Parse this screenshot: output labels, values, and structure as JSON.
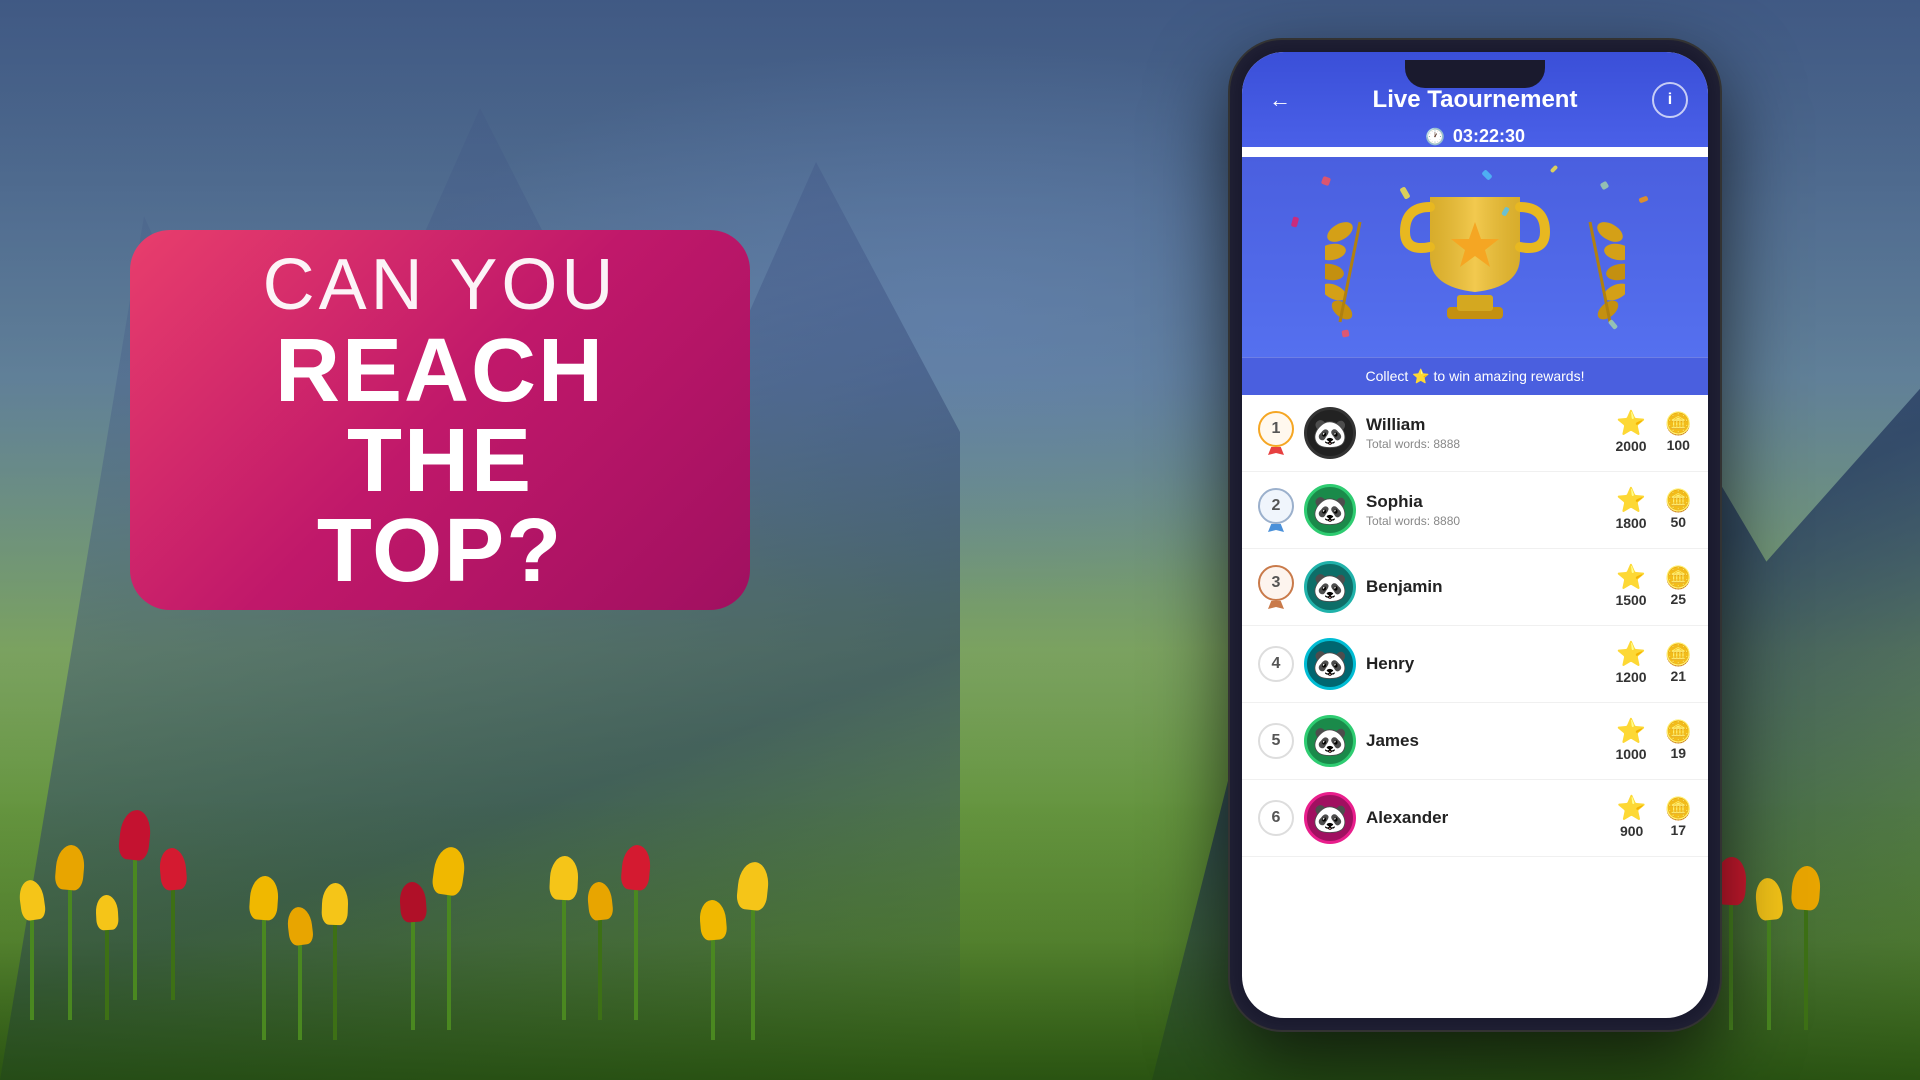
{
  "background": {
    "gradient_desc": "mountain tulip field background"
  },
  "promo": {
    "line1": "CAN YOU",
    "line2": "REACH THE",
    "line3": "TOP?"
  },
  "phone": {
    "header": {
      "title": "Live Taournement",
      "timer": "03:22:30",
      "back_label": "←",
      "info_label": "i"
    },
    "reward_bar": {
      "text": "Collect ⭐ to win amazing rewards!"
    },
    "leaderboard": {
      "rows": [
        {
          "rank": 1,
          "rank_type": "gold",
          "name": "William",
          "sub": "Total words: 8888",
          "score": 2000,
          "coins": 100,
          "avatar_type": "dark"
        },
        {
          "rank": 2,
          "rank_type": "silver",
          "name": "Sophia",
          "sub": "Total words: 8880",
          "score": 1800,
          "coins": 50,
          "avatar_type": "green"
        },
        {
          "rank": 3,
          "rank_type": "bronze",
          "name": "Benjamin",
          "sub": "",
          "score": 1500,
          "coins": 25,
          "avatar_type": "teal"
        },
        {
          "rank": 4,
          "rank_type": "normal",
          "name": "Henry",
          "sub": "",
          "score": 1200,
          "coins": 21,
          "avatar_type": "cyan"
        },
        {
          "rank": 5,
          "rank_type": "normal",
          "name": "James",
          "sub": "",
          "score": 1000,
          "coins": 19,
          "avatar_type": "green"
        },
        {
          "rank": 6,
          "rank_type": "normal",
          "name": "Alexander",
          "sub": "",
          "score": 900,
          "coins": 17,
          "avatar_type": "pink"
        }
      ]
    }
  }
}
